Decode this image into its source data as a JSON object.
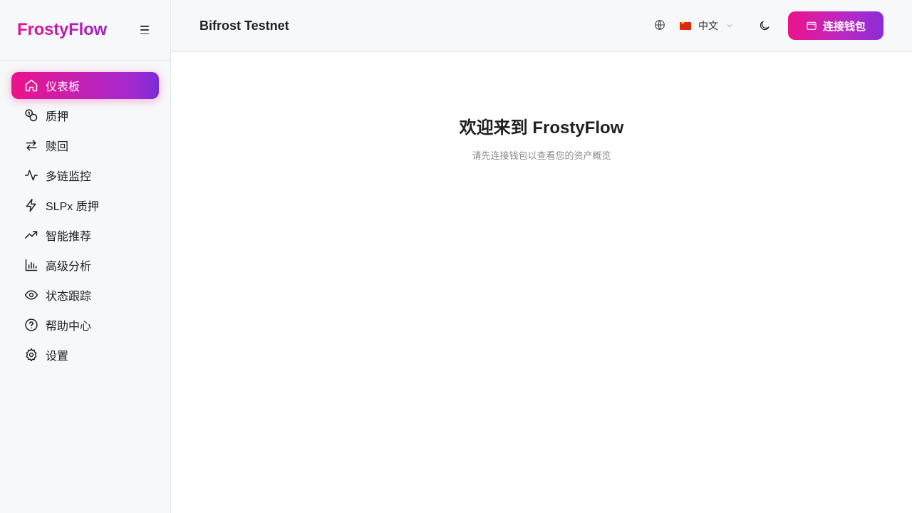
{
  "app": {
    "brand": "FrostyFlow"
  },
  "sidebar": {
    "items": [
      {
        "label": "仪表板",
        "icon": "home-icon",
        "active": true
      },
      {
        "label": "质押",
        "icon": "coins-icon",
        "active": false
      },
      {
        "label": "赎回",
        "icon": "arrows-swap-icon",
        "active": false
      },
      {
        "label": "多链监控",
        "icon": "activity-icon",
        "active": false
      },
      {
        "label": "SLPx 质押",
        "icon": "lightning-icon",
        "active": false
      },
      {
        "label": "智能推荐",
        "icon": "trending-up-icon",
        "active": false
      },
      {
        "label": "高级分析",
        "icon": "bar-chart-icon",
        "active": false
      },
      {
        "label": "状态跟踪",
        "icon": "eye-icon",
        "active": false
      },
      {
        "label": "帮助中心",
        "icon": "help-circle-icon",
        "active": false
      },
      {
        "label": "设置",
        "icon": "gear-icon",
        "active": false
      }
    ]
  },
  "header": {
    "network": "Bifrost Testnet",
    "language": "中文",
    "connect_label": "连接钱包"
  },
  "main": {
    "title": "欢迎来到 FrostyFlow",
    "subtitle": "请先连接钱包以查看您的资产概览"
  },
  "colors": {
    "accent_start": "#ec138a",
    "accent_end": "#8a2cd6",
    "sidebar_bg": "#f7f8fa"
  }
}
